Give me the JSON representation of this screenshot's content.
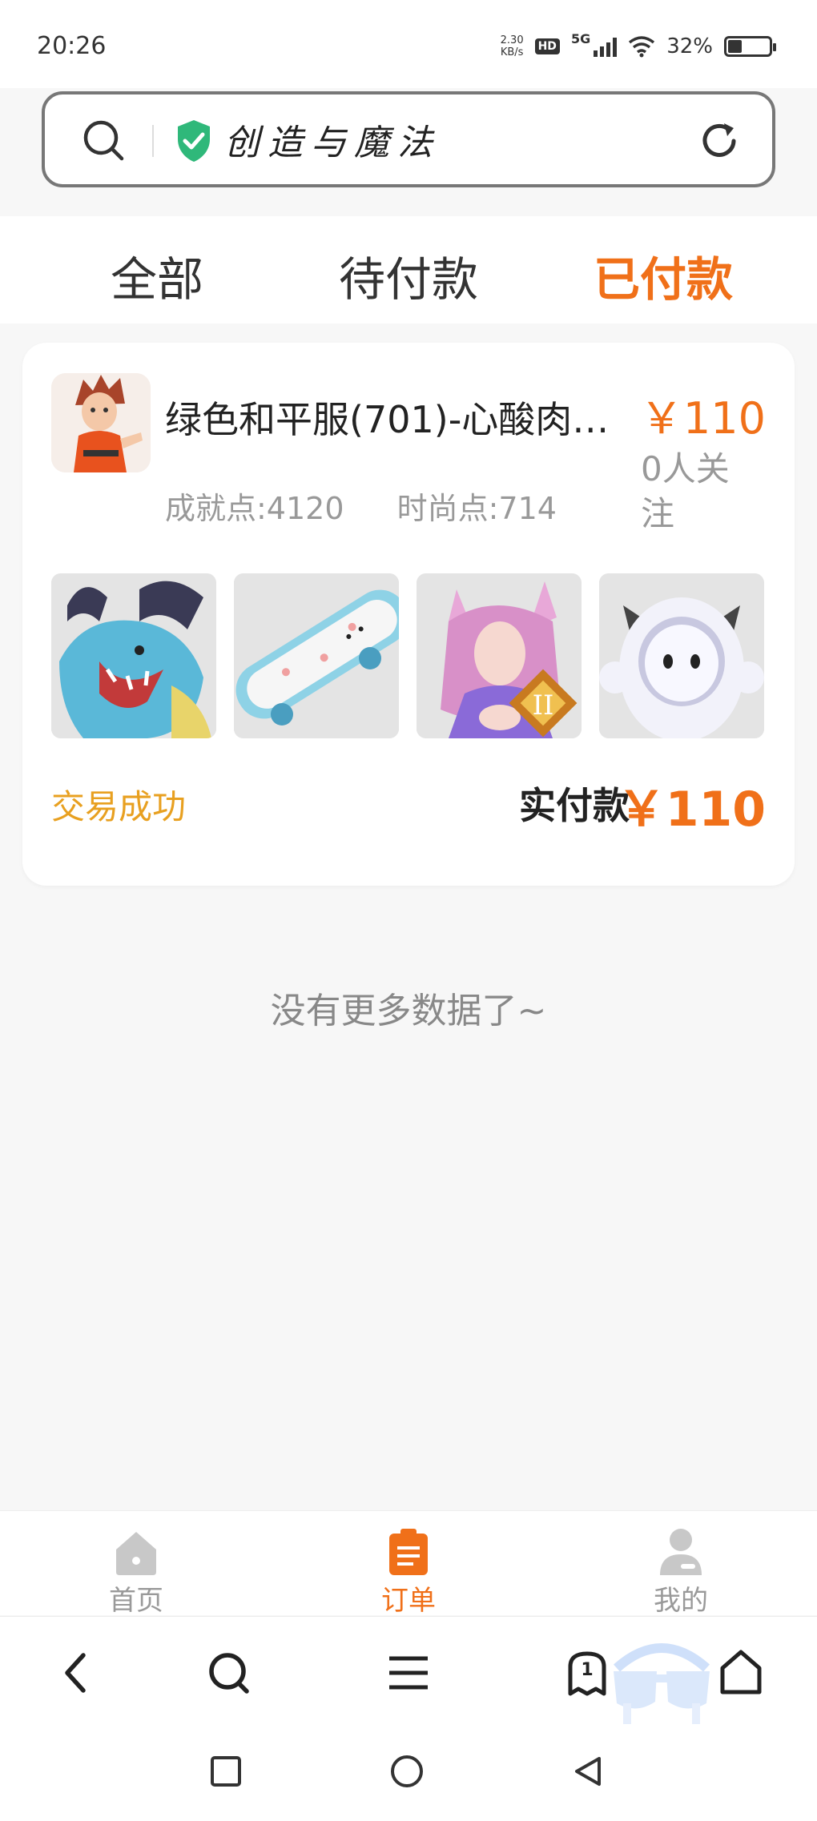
{
  "status_bar": {
    "time": "20:26",
    "net_speed_value": "2.30",
    "net_speed_unit": "KB/s",
    "hd": "HD",
    "network": "5G",
    "battery": "32%",
    "battery_level": 0.32
  },
  "address_bar": {
    "title": "创造与魔法"
  },
  "tabs": [
    {
      "label": "全部",
      "active": false
    },
    {
      "label": "待付款",
      "active": false
    },
    {
      "label": "已付款",
      "active": true
    }
  ],
  "order": {
    "title": "绿色和平服(701)-心酸肉…",
    "price": "￥110",
    "followers": "0人关注",
    "achievement_points": "成就点:4120",
    "fashion_points": "时尚点:714",
    "status": "交易成功",
    "paid_label": "实付款",
    "paid_amount": "￥110",
    "thumbnails": [
      "dragon-mount",
      "bear-skateboard",
      "fox-fairy-skin",
      "cow-robot-pet"
    ]
  },
  "footer_text": "没有更多数据了~",
  "bottom_nav": [
    {
      "label": "首页",
      "icon": "home-icon",
      "active": false
    },
    {
      "label": "订单",
      "icon": "order-icon",
      "active": true
    },
    {
      "label": "我的",
      "icon": "profile-icon",
      "active": false
    }
  ],
  "browser_bar": {
    "tabs_count": "1"
  },
  "colors": {
    "accent": "#f07019",
    "success": "#e8a020",
    "muted": "#999999"
  }
}
